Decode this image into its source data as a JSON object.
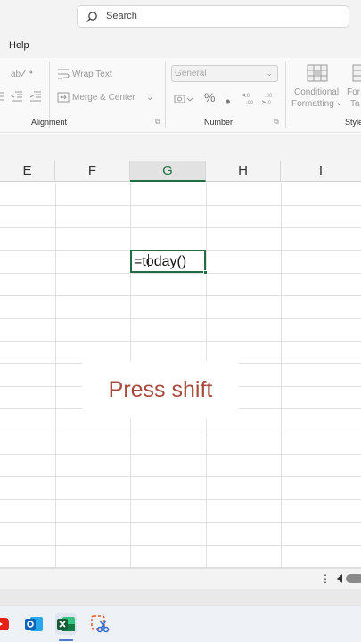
{
  "search": {
    "label": "Search"
  },
  "menu": {
    "help": "Help"
  },
  "ribbon": {
    "alignment": {
      "wrap_text": "Wrap Text",
      "merge_center": "Merge & Center",
      "group_label": "Alignment"
    },
    "number": {
      "format_value": "General",
      "group_label": "Number"
    },
    "styles": {
      "conditional_line1": "Conditional",
      "conditional_line2": "Formatting",
      "format_as_line1": "For",
      "format_as_line2": "Ta",
      "group_label": "Style"
    }
  },
  "columns": [
    "E",
    "F",
    "G",
    "H",
    "I"
  ],
  "selected_column": "G",
  "active_cell": {
    "content": "=today()"
  },
  "caption": "Press shift",
  "sheetbar": {
    "more": "⋮"
  },
  "taskbar": {
    "icons": [
      "youtube-icon",
      "outlook-icon",
      "excel-icon",
      "snipping-tool-icon"
    ]
  },
  "colors": {
    "excel_green": "#1f6e43",
    "caption_text": "#a94a3c"
  }
}
